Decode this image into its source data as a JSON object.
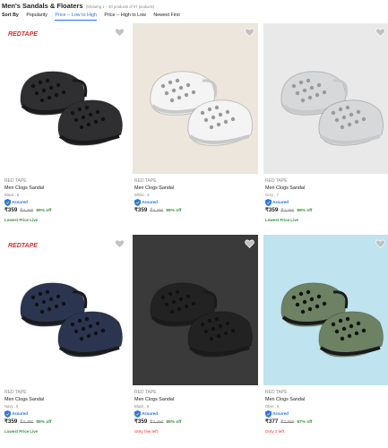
{
  "header": {
    "title": "Men's Sandals & Floaters",
    "subtitle": "(Showing 1 – 40 products of 97 products)",
    "sort_label": "Sort By",
    "sort_options": [
      "Popularity",
      "Price -- Low to High",
      "Price -- High to Low",
      "Newest First"
    ],
    "active_sort": "Price -- Low to High"
  },
  "products": [
    {
      "brand": "RED TAPE",
      "name": "Men Clogs Sandal",
      "variant": "Black , 6",
      "assured": "Assured",
      "price": "₹359",
      "mrp": "₹3,490",
      "discount": "89% off",
      "tag": "Lowest Price Live",
      "tag_color": "#388e3c",
      "shoe_color": "#2f2f31",
      "bg": "#ffffff",
      "logo": "REDTAPE"
    },
    {
      "brand": "RED TAPE",
      "name": "Men Clogs Sandal",
      "variant": "White , 6",
      "assured": "Assured",
      "price": "₹359",
      "mrp": "₹3,490",
      "discount": "89% off",
      "tag": "",
      "tag_color": "#388e3c",
      "shoe_color": "#f4f4f4",
      "bg": "#ece6dc",
      "logo": ""
    },
    {
      "brand": "RED TAPE",
      "name": "Men Clogs Sandal",
      "variant": "Grey , 7",
      "assured": "Assured",
      "price": "₹359",
      "mrp": "₹3,490",
      "discount": "89% off",
      "tag": "Lowest Price Live",
      "tag_color": "#388e3c",
      "shoe_color": "#d7d8da",
      "bg": "#e9e9e9",
      "logo": ""
    },
    {
      "brand": "RED TAPE",
      "name": "Men Clogs Sandal",
      "variant": "Navy , 6",
      "assured": "Assured",
      "price": "₹359",
      "mrp": "₹3,490",
      "discount": "89% off",
      "tag": "Lowest Price Live",
      "tag_color": "#388e3c",
      "shoe_color": "#2b3550",
      "bg": "#ffffff",
      "logo": "REDTAPE"
    },
    {
      "brand": "RED TAPE",
      "name": "Men Clogs Sandal",
      "variant": "Black , 6",
      "assured": "Assured",
      "price": "₹359",
      "mrp": "₹3,490",
      "discount": "89% off",
      "tag": "Only few left",
      "tag_color": "#ff6161",
      "shoe_color": "#222222",
      "bg": "#3a3a3a",
      "logo": ""
    },
    {
      "brand": "RED TAPE",
      "name": "Men Clogs Sandal",
      "variant": "Olive , 6",
      "assured": "Assured",
      "price": "₹377",
      "mrp": "₹2,990",
      "discount": "87% off",
      "tag": "Only 2 left",
      "tag_color": "#ff6161",
      "shoe_color": "#6d8163",
      "bg": "#bfe3ef",
      "logo": ""
    }
  ]
}
